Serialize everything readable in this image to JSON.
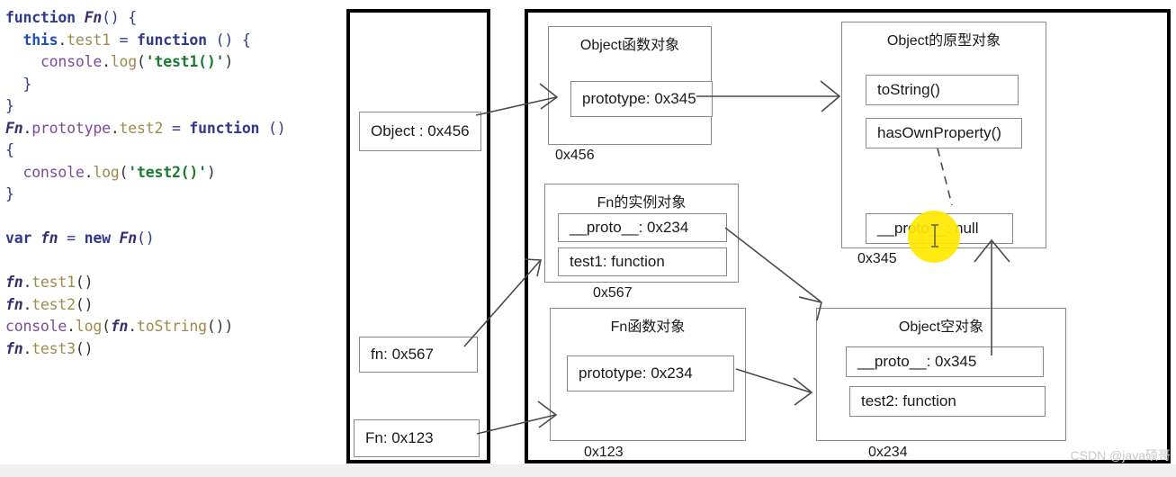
{
  "code": {
    "lines": [
      [
        {
          "t": "function ",
          "c": "kw"
        },
        {
          "t": "Fn",
          "c": "id"
        },
        {
          "t": "() {",
          "c": "plain"
        }
      ],
      [
        {
          "t": "  ",
          "c": "plain"
        },
        {
          "t": "this",
          "c": "this"
        },
        {
          "t": ".",
          "c": "pun"
        },
        {
          "t": "test1",
          "c": "prop"
        },
        {
          "t": " = ",
          "c": "plain"
        },
        {
          "t": "function",
          "c": "kw"
        },
        {
          "t": " () {",
          "c": "plain"
        }
      ],
      [
        {
          "t": "    ",
          "c": "plain"
        },
        {
          "t": "console",
          "c": "obj"
        },
        {
          "t": ".",
          "c": "pun"
        },
        {
          "t": "log",
          "c": "prop"
        },
        {
          "t": "(",
          "c": "pun"
        },
        {
          "t": "'test1()'",
          "c": "str"
        },
        {
          "t": ")",
          "c": "pun"
        }
      ],
      [
        {
          "t": "  }",
          "c": "plain"
        }
      ],
      [
        {
          "t": "}",
          "c": "plain"
        }
      ],
      [
        {
          "t": "Fn",
          "c": "id"
        },
        {
          "t": ".",
          "c": "pun"
        },
        {
          "t": "prototype",
          "c": "obj"
        },
        {
          "t": ".",
          "c": "pun"
        },
        {
          "t": "test2",
          "c": "prop"
        },
        {
          "t": " = ",
          "c": "plain"
        },
        {
          "t": "function",
          "c": "kw"
        },
        {
          "t": " ()",
          "c": "plain"
        }
      ],
      [
        {
          "t": "{",
          "c": "plain"
        }
      ],
      [
        {
          "t": "  ",
          "c": "plain"
        },
        {
          "t": "console",
          "c": "obj"
        },
        {
          "t": ".",
          "c": "pun"
        },
        {
          "t": "log",
          "c": "prop"
        },
        {
          "t": "(",
          "c": "pun"
        },
        {
          "t": "'test2()'",
          "c": "str"
        },
        {
          "t": ")",
          "c": "pun"
        }
      ],
      [
        {
          "t": "}",
          "c": "plain"
        }
      ],
      [
        {
          "t": "",
          "c": "plain"
        }
      ],
      [
        {
          "t": "var ",
          "c": "kw"
        },
        {
          "t": "fn",
          "c": "id"
        },
        {
          "t": " = ",
          "c": "plain"
        },
        {
          "t": "new ",
          "c": "kw"
        },
        {
          "t": "Fn",
          "c": "id"
        },
        {
          "t": "()",
          "c": "plain"
        }
      ],
      [
        {
          "t": "",
          "c": "plain"
        }
      ],
      [
        {
          "t": "fn",
          "c": "id"
        },
        {
          "t": ".",
          "c": "pun"
        },
        {
          "t": "test1",
          "c": "prop"
        },
        {
          "t": "()",
          "c": "pun"
        }
      ],
      [
        {
          "t": "fn",
          "c": "id"
        },
        {
          "t": ".",
          "c": "pun"
        },
        {
          "t": "test2",
          "c": "prop"
        },
        {
          "t": "()",
          "c": "pun"
        }
      ],
      [
        {
          "t": "console",
          "c": "obj"
        },
        {
          "t": ".",
          "c": "pun"
        },
        {
          "t": "log",
          "c": "prop"
        },
        {
          "t": "(",
          "c": "pun"
        },
        {
          "t": "fn",
          "c": "id"
        },
        {
          "t": ".",
          "c": "pun"
        },
        {
          "t": "toString",
          "c": "prop"
        },
        {
          "t": "())",
          "c": "pun"
        }
      ],
      [
        {
          "t": "fn",
          "c": "id"
        },
        {
          "t": ".",
          "c": "pun"
        },
        {
          "t": "test3",
          "c": "prop"
        },
        {
          "t": "()",
          "c": "pun"
        }
      ]
    ]
  },
  "stack": {
    "title": "stack-panel",
    "vars": [
      {
        "label": "Object : 0x456"
      },
      {
        "label": "fn: 0x567"
      },
      {
        "label": "Fn: 0x123"
      }
    ]
  },
  "heap": {
    "objects": [
      {
        "title": "Object函数对象",
        "address": "0x456",
        "props": [
          {
            "label": "prototype: 0x345"
          }
        ]
      },
      {
        "title": "Fn的实例对象",
        "address": "0x567",
        "props": [
          {
            "label": "__proto__: 0x234"
          },
          {
            "label": "test1: function"
          }
        ]
      },
      {
        "title": "Fn函数对象",
        "address": "0x123",
        "props": [
          {
            "label": "prototype: 0x234"
          }
        ]
      },
      {
        "title": "Object的原型对象",
        "address": "0x345",
        "props": [
          {
            "label": "toString()"
          },
          {
            "label": "hasOwnProperty()"
          },
          {
            "label": "__proto__: null"
          }
        ]
      },
      {
        "title": "Object空对象",
        "address": "0x234",
        "props": [
          {
            "label": "__proto__: 0x345"
          },
          {
            "label": "test2: function"
          }
        ]
      }
    ]
  },
  "cursor": {
    "highlight_color": "#ffe800",
    "kind": "text-ibeam"
  },
  "watermark": {
    "text": "CSDN @java硕哥"
  }
}
